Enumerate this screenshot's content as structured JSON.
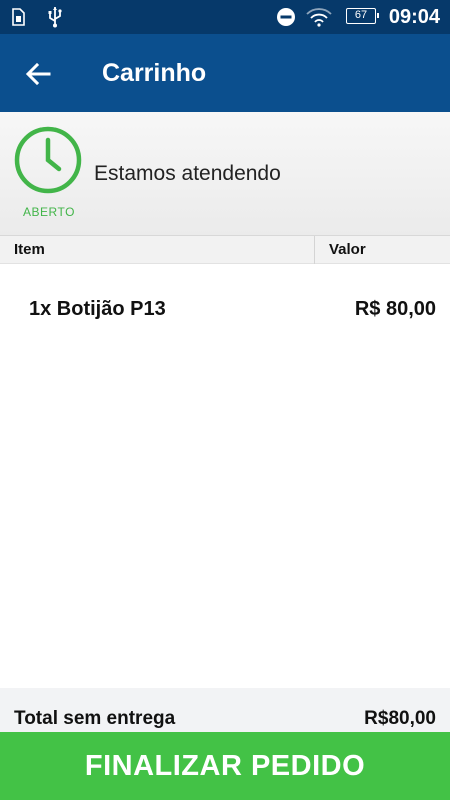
{
  "status_bar": {
    "time": "09:04",
    "battery": "67",
    "icons": [
      "sim-card-icon",
      "usb-icon",
      "do-not-disturb-icon",
      "wifi-icon",
      "battery-icon"
    ]
  },
  "app_bar": {
    "title": "Carrinho",
    "back_icon": "arrow-left-icon"
  },
  "store_status": {
    "badge": "ABERTO",
    "message": "Estamos atendendo",
    "icon": "clock-icon",
    "color": "#42b549"
  },
  "table": {
    "columns": [
      "Item",
      "Valor"
    ],
    "rows": [
      {
        "item": "1x Botijão P13",
        "value": "R$ 80,00"
      }
    ]
  },
  "total": {
    "label": "Total sem entrega",
    "value": "R$80,00"
  },
  "finalize_button": {
    "label": "FINALIZAR PEDIDO",
    "color": "#43c246"
  },
  "colors": {
    "status_bar": "#06396a",
    "app_bar": "#0b4f8e"
  }
}
